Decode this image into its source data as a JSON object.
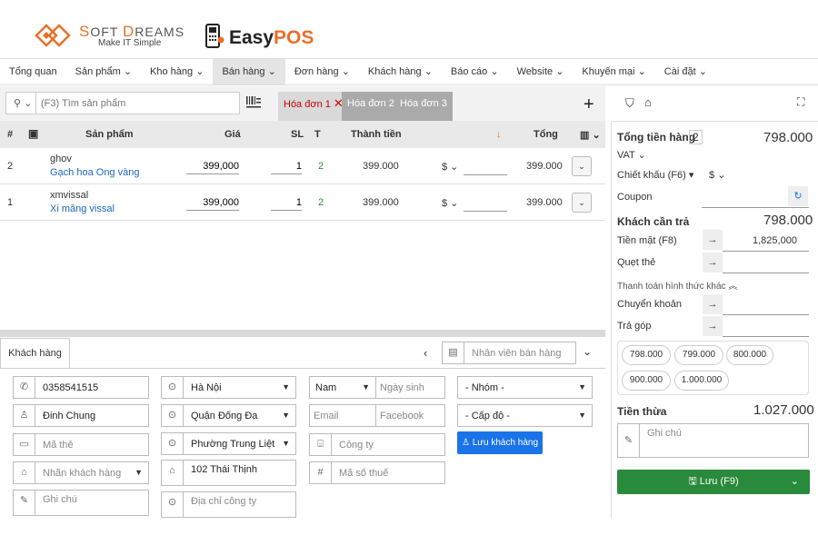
{
  "brand": {
    "softdreams_name_part1": "S",
    "softdreams_name_part2": "OFT ",
    "softdreams_name_part3": "D",
    "softdreams_name_part4": "REAMS",
    "softdreams_tagline": "Make IT Simple",
    "easypos_part1": "Easy",
    "easypos_part2": "POS"
  },
  "nav": [
    "Tổng quan",
    "Sản phẩm",
    "Kho hàng",
    "Bán hàng",
    "Đơn hàng",
    "Khách hàng",
    "Báo cáo",
    "Website",
    "Khuyến mại",
    "Cài đặt"
  ],
  "search": {
    "placeholder": "(F3) Tìm sản phẩm"
  },
  "tabs": [
    "Hóa đơn 1",
    "Hóa đơn 2",
    "Hóa đơn 3"
  ],
  "table": {
    "headers": {
      "num": "#",
      "product": "Sản phẩm",
      "price": "Giá",
      "qty": "SL",
      "t": "T",
      "amount": "Thành tiền",
      "total": "Tổng"
    },
    "rows": [
      {
        "num": "2",
        "name": "ghov",
        "desc": "Gạch hoa Ong vàng",
        "price": "399,000",
        "qty": "1",
        "t": "2",
        "amount": "399.000",
        "currency": "$",
        "total": "399.000"
      },
      {
        "num": "1",
        "name": "xmvissal",
        "desc": "Xi măng vissal",
        "price": "399,000",
        "qty": "1",
        "t": "2",
        "amount": "399.000",
        "currency": "$",
        "total": "399.000"
      }
    ]
  },
  "customer": {
    "tab_label": "Khách hàng",
    "staff_placeholder": "Nhân viên bán hàng",
    "phone": "0358541515",
    "name": "Đinh Chung",
    "card_placeholder": "Mã thẻ",
    "label_placeholder": "Nhãn khách hàng",
    "note_placeholder": "Ghi chú",
    "city": "Hà Nội",
    "district": "Quận Đống Đa",
    "ward": "Phường Trung Liệt",
    "address": "102 Thái Thịnh",
    "company_address_placeholder": "Địa chỉ công ty",
    "gender": "Nam",
    "birthday_placeholder": "Ngày sinh",
    "email_placeholder": "Email",
    "facebook_placeholder": "Facebook",
    "company_placeholder": "Công ty",
    "tax_placeholder": "Mã số thuế",
    "group": "- Nhóm -",
    "level": "- Cấp độ -",
    "save_label": "Lưu khách hàng"
  },
  "payment": {
    "total_label": "Tổng tiền hàng",
    "total_count": "2",
    "total_value": "798.000",
    "vat_label": "VAT",
    "discount_label": "Chiết khấu (F6)",
    "discount_currency": "$",
    "coupon_label": "Coupon",
    "due_label": "Khách cần trả",
    "due_value": "798.000",
    "cash_label": "Tiền mặt (F8)",
    "cash_value": "1,825,000",
    "card_label": "Quẹt thẻ",
    "other_label": "Thanh toán hình thức khác",
    "transfer_label": "Chuyển khoản",
    "installment_label": "Trả góp",
    "chips": [
      "798.000",
      "799.000",
      "800.000",
      "900.000",
      "1.000.000"
    ],
    "change_label": "Tiền thừa",
    "change_value": "1.027.000",
    "note_placeholder": "Ghi chú",
    "save_label": "Lưu (F9)"
  },
  "colors": {
    "accent_orange": "#e8702a",
    "green": "#2a8a3c",
    "blue": "#1a73e8",
    "link": "#1a65c0"
  }
}
